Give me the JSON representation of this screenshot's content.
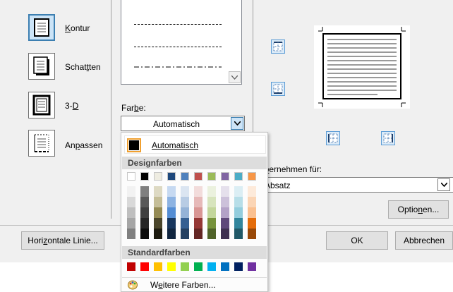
{
  "settings": {
    "items": [
      {
        "label": "Kontur",
        "accel": "K",
        "rest": "ontur",
        "pre": ""
      },
      {
        "label": "Schatten",
        "accel": "t",
        "pre": "Schat",
        "rest": "ten"
      },
      {
        "label": "3-D",
        "accel": "D",
        "pre": "3-",
        "rest": ""
      },
      {
        "label": "Anpassen",
        "accel": "p",
        "pre": "An",
        "rest": "assen"
      }
    ]
  },
  "color": {
    "label_pre": "Far",
    "label_accel": "b",
    "label_post": "e:",
    "value": "Automatisch"
  },
  "apply": {
    "label_pre": "Ü",
    "label_accel": "b",
    "label_post": "ernehmen für:",
    "value": "Absatz"
  },
  "buttons": {
    "options_pre": "Optio",
    "options_accel": "n",
    "options_post": "en...",
    "horizontal_pre": "Hori",
    "horizontal_accel": "z",
    "horizontal_post": "ontale Linie...",
    "ok": "OK",
    "cancel": "Abbrechen"
  },
  "color_popup": {
    "automatic_label": "Automatisch",
    "theme_header": "Designfarben",
    "standard_header": "Standardfarben",
    "more_colors": "Weitere Farben...",
    "theme_colors": [
      [
        "#ffffff",
        "#f2f2f2",
        "#d9d9d9",
        "#bfbfbf",
        "#a6a6a6",
        "#808080"
      ],
      [
        "#000000",
        "#7f7f7f",
        "#595959",
        "#404040",
        "#262626",
        "#0d0d0d"
      ],
      [
        "#eeece1",
        "#ddd9c3",
        "#c4bd97",
        "#948a54",
        "#4a452a",
        "#1d1b10"
      ],
      [
        "#1f497d",
        "#c6d9f1",
        "#8db3e2",
        "#548dd4",
        "#17365d",
        "#0f243e"
      ],
      [
        "#4f81bd",
        "#dbe5f1",
        "#b8cce4",
        "#95b3d7",
        "#366092",
        "#244061"
      ],
      [
        "#c0504d",
        "#f2dcdb",
        "#e6b9b8",
        "#d99694",
        "#953735",
        "#632523"
      ],
      [
        "#9bbb59",
        "#ebf1de",
        "#d7e4bd",
        "#c3d69b",
        "#77933c",
        "#4f6228"
      ],
      [
        "#8064a2",
        "#e5e0ec",
        "#ccc1da",
        "#b3a2c7",
        "#5f497a",
        "#3f3151"
      ],
      [
        "#4bacc6",
        "#dbeef4",
        "#b7dee8",
        "#93cddd",
        "#31859c",
        "#205867"
      ],
      [
        "#f79646",
        "#fdeada",
        "#fbd5b5",
        "#fac090",
        "#e46c0a",
        "#984807"
      ]
    ],
    "standard_colors": [
      "#c00000",
      "#ff0000",
      "#ffc000",
      "#ffff00",
      "#92d050",
      "#00b050",
      "#00b0f0",
      "#0070c0",
      "#002060",
      "#7030a0"
    ]
  }
}
